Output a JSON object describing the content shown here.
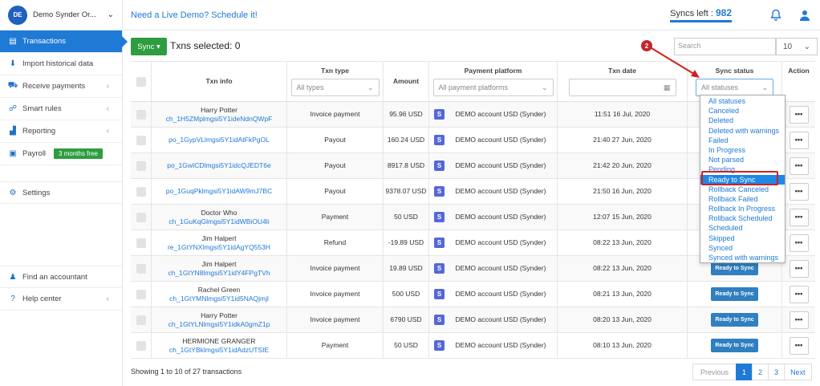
{
  "org": {
    "initials": "DE",
    "name": "Demo Synder Or..."
  },
  "sidebar": {
    "items": [
      {
        "label": "Transactions"
      },
      {
        "label": "Import historical data"
      },
      {
        "label": "Receive payments"
      },
      {
        "label": "Smart rules"
      },
      {
        "label": "Reporting"
      },
      {
        "label": "Payroll",
        "badge": "3 months free"
      },
      {
        "label": "Settings"
      },
      {
        "label": "Find an accountant"
      },
      {
        "label": "Help center"
      }
    ]
  },
  "header": {
    "demo_link": "Need a Live Demo? Schedule it!",
    "syncs_label": "Syncs left :",
    "syncs_value": "982"
  },
  "toolbar": {
    "sync_label": "Sync ▾",
    "selected_text": "Txns selected: 0",
    "search_placeholder": "Search",
    "per_page": "10"
  },
  "table": {
    "headers": {
      "info": "Txn info",
      "type": "Txn type",
      "amount": "Amount",
      "platform": "Payment platform",
      "date": "Txn date",
      "status": "Sync status",
      "action": "Action"
    },
    "filters": {
      "type": "All types",
      "platform": "All payment platforms",
      "status": "All statuses"
    },
    "rows": [
      {
        "name": "Harry Potter",
        "id": "ch_1H5ZMplmgsi5Y1ideNdnQWpF",
        "type": "Invoice payment",
        "amount": "95.96 USD",
        "platform": "DEMO account USD (Synder)",
        "date": "11:51 16 Jul, 2020",
        "status": ""
      },
      {
        "name": "",
        "id": "po_1GypVLlmgsi5Y1idAtFkPgOL",
        "type": "Payout",
        "amount": "160.24 USD",
        "platform": "DEMO account USD (Synder)",
        "date": "21:40 27 Jun, 2020",
        "status": ""
      },
      {
        "name": "",
        "id": "po_1GwICDlmgsi5Y1idcQJEDT6e",
        "type": "Payout",
        "amount": "8917.8 USD",
        "platform": "DEMO account USD (Synder)",
        "date": "21:42 20 Jun, 2020",
        "status": ""
      },
      {
        "name": "",
        "id": "po_1GuqPklmgsi5Y1idAW9mJ7BC",
        "type": "Payout",
        "amount": "9378.07 USD",
        "platform": "DEMO account USD (Synder)",
        "date": "21:50 16 Jun, 2020",
        "status": ""
      },
      {
        "name": "Doctor Who",
        "id": "ch_1GuKqGlmgsi5Y1idWBiOU4li",
        "type": "Payment",
        "amount": "50 USD",
        "platform": "DEMO account USD (Synder)",
        "date": "12:07 15 Jun, 2020",
        "status": ""
      },
      {
        "name": "Jim Halpert",
        "id": "re_1GtYNXlmgsi5Y1idAgYQ553H",
        "type": "Refund",
        "amount": "-19.89 USD",
        "platform": "DEMO account USD (Synder)",
        "date": "08:22 13 Jun, 2020",
        "status": ""
      },
      {
        "name": "Jim Halpert",
        "id": "ch_1GtYN8lmgsi5Y1idY4FPgTVh",
        "type": "Invoice payment",
        "amount": "19.89 USD",
        "platform": "DEMO account USD (Synder)",
        "date": "08:22 13 Jun, 2020",
        "status": "Ready to Sync"
      },
      {
        "name": "Rachel Green",
        "id": "ch_1GtYMNlmgsi5Y1id5NAQjmjl",
        "type": "Invoice payment",
        "amount": "500 USD",
        "platform": "DEMO account USD (Synder)",
        "date": "08:21 13 Jun, 2020",
        "status": "Ready to Sync"
      },
      {
        "name": "Harry Potter",
        "id": "ch_1GtYLNlmgsi5Y1idkA0gmZ1p",
        "type": "Invoice payment",
        "amount": "6790 USD",
        "platform": "DEMO account USD (Synder)",
        "date": "08:20 13 Jun, 2020",
        "status": "Ready to Sync"
      },
      {
        "name": "HERMIONE GRANGER",
        "id": "ch_1GtYBklmgsi5Y1idAdzUTSIE",
        "type": "Payment",
        "amount": "50 USD",
        "platform": "DEMO account USD (Synder)",
        "date": "08:10 13 Jun, 2020",
        "status": "Ready to Sync"
      }
    ]
  },
  "status_dropdown": {
    "options": [
      "All statuses",
      "Canceled",
      "Deleted",
      "Deleted with warnings",
      "Failed",
      "In Progress",
      "Not parsed",
      "Pending",
      "Ready to Sync",
      "Rollback Canceled",
      "Rollback Failed",
      "Rollback In Progress",
      "Rollback Scheduled",
      "Scheduled",
      "Skipped",
      "Synced",
      "Synced with warnings"
    ],
    "selected": "Ready to Sync"
  },
  "annotation": {
    "step": "2"
  },
  "footer": {
    "showing": "Showing 1 to 10 of 27 transactions",
    "pages": [
      "Previous",
      "1",
      "2",
      "3",
      "Next"
    ]
  },
  "colors": {
    "accent": "#1f7ad6",
    "sync_green": "#2d9d3f",
    "highlight_red": "#d21f1f"
  }
}
